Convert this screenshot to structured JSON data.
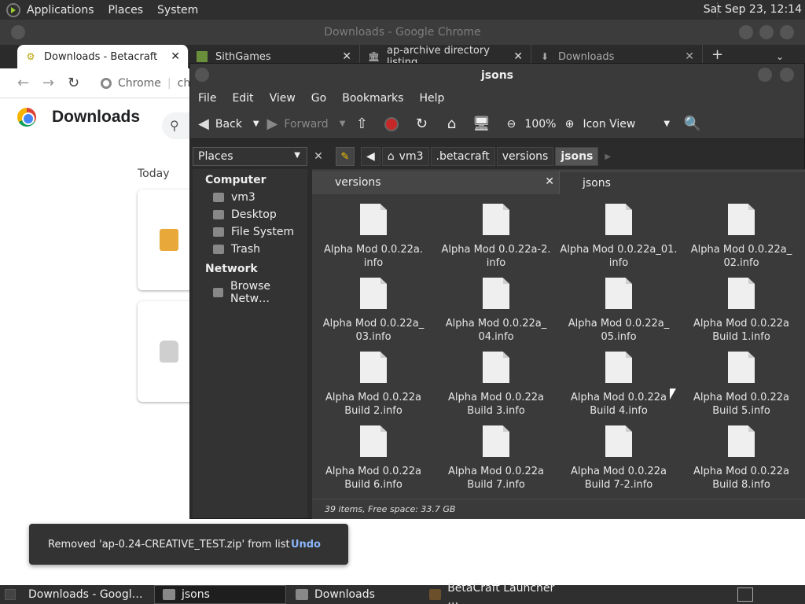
{
  "top_panel": {
    "menus": [
      "Applications",
      "Places",
      "System"
    ],
    "clock": "Sat Sep 23, 12:14"
  },
  "chrome": {
    "window_title": "Downloads - Google Chrome",
    "tabs": [
      {
        "label": "Downloads - Betacraft",
        "icon": "betacraft-icon",
        "active": true
      },
      {
        "label": "SithGames",
        "icon": "grass-block-icon",
        "active": false
      },
      {
        "label": "ap-archive directory listing",
        "icon": "archive-icon",
        "active": false
      },
      {
        "label": "Downloads",
        "icon": "download-icon",
        "active": false
      }
    ],
    "omnibox_label": "Chrome",
    "omnibox_text": "chr",
    "page_title": "Downloads",
    "today_label": "Today"
  },
  "nautilus": {
    "window_title": "jsons",
    "menus": [
      "File",
      "Edit",
      "View",
      "Go",
      "Bookmarks",
      "Help"
    ],
    "toolbar": {
      "back": "Back",
      "forward": "Forward",
      "zoom": "100%",
      "view_mode": "Icon View"
    },
    "places_label": "Places",
    "breadcrumbs": [
      "vm3",
      ".betacraft",
      "versions",
      "jsons"
    ],
    "sidebar": {
      "computer_heading": "Computer",
      "computer_items": [
        "vm3",
        "Desktop",
        "File System",
        "Trash"
      ],
      "network_heading": "Network",
      "network_items": [
        "Browse Netw…"
      ]
    },
    "view_tabs": [
      "versions",
      "jsons"
    ],
    "files": [
      "Alpha Mod 0.0.22a.\ninfo",
      "Alpha Mod 0.0.22a-2.\ninfo",
      "Alpha Mod 0.0.22a_01.\ninfo",
      "Alpha Mod 0.0.22a_\n02.info",
      "Alpha Mod 0.0.22a_\n03.info",
      "Alpha Mod 0.0.22a_\n04.info",
      "Alpha Mod 0.0.22a_\n05.info",
      "Alpha Mod 0.0.22a\nBuild 1.info",
      "Alpha Mod 0.0.22a\nBuild 2.info",
      "Alpha Mod 0.0.22a\nBuild 3.info",
      "Alpha Mod 0.0.22a\nBuild 4.info",
      "Alpha Mod 0.0.22a\nBuild 5.info",
      "Alpha Mod 0.0.22a\nBuild 6.info",
      "Alpha Mod 0.0.22a\nBuild 7.info",
      "Alpha Mod 0.0.22a\nBuild 7-2.info",
      "Alpha Mod 0.0.22a\nBuild 8.info"
    ],
    "status": "39 items, Free space: 33.7 GB"
  },
  "toast": {
    "message": "Removed 'ap-0.24-CREATIVE_TEST.zip' from list",
    "action": "Undo"
  },
  "taskbar": {
    "tasks": [
      {
        "label": "Downloads - Googl…",
        "icon": "chrome-icon",
        "active": false
      },
      {
        "label": "jsons",
        "icon": "folder-icon",
        "active": true
      },
      {
        "label": "Downloads",
        "icon": "folder-icon",
        "active": false
      },
      {
        "label": "BetaCraft Launcher …",
        "icon": "java-icon",
        "active": false
      }
    ]
  }
}
